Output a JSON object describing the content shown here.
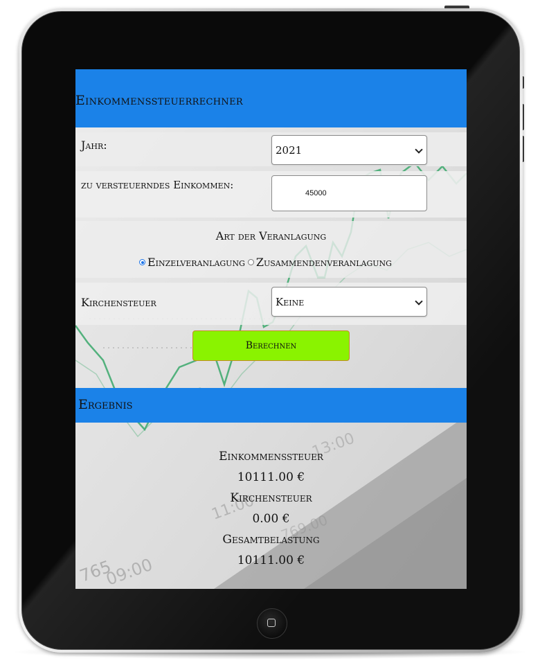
{
  "app": {
    "title": "Einkommenssteuerrechner"
  },
  "form": {
    "year_label": "Jahr:",
    "year_value": "2021",
    "income_label": "zu versteuerndes Einkommen:",
    "income_value": "45000",
    "mode_title": "Art der Veranlagung",
    "mode_options": [
      {
        "label": "Einzelveranlagung",
        "checked": true
      },
      {
        "label": "Zusammendenveranlagung",
        "checked": false
      }
    ],
    "church_label": "Kirchensteuer",
    "church_value": "Keine",
    "calculate_label": "Berechnen"
  },
  "result": {
    "title": "Ergebnis",
    "income_tax_label": "Einkommenssteuer",
    "income_tax_value": "10111.00 €",
    "church_tax_label": "Kirchensteuer",
    "church_tax_value": "0.00 €",
    "total_label": "Gesamtbelastung",
    "total_value": "10111.00 €"
  },
  "background": {
    "deco_texts": [
      "765",
      "09:00",
      "11:00",
      "13:00",
      "769.00"
    ]
  },
  "colors": {
    "header_blue": "#1b82e8",
    "button_green": "#8af300",
    "chart_line_green": "#3aa86b",
    "device_black": "#0a0a0a"
  },
  "icons": {
    "select_arrow": "chevron-down-icon",
    "home": "home-button-icon"
  }
}
